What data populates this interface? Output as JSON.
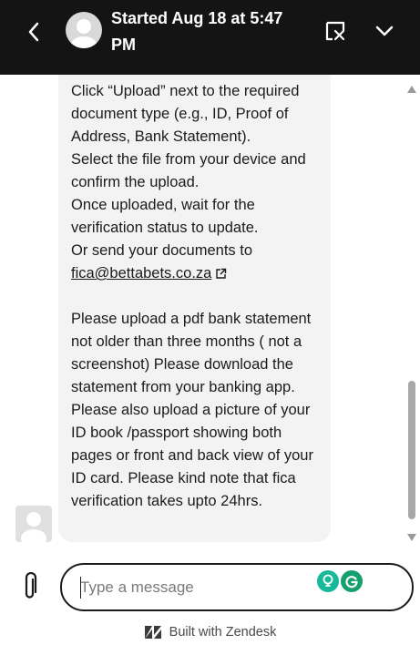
{
  "header": {
    "title": "Started Aug 18 at 5:47 PM",
    "back_icon": "chevron-left-icon",
    "end_chat_icon": "end-chat-icon",
    "minimize_icon": "chevron-down-icon"
  },
  "message": {
    "text_part1": "Click “Upload” next to the required document type (e.g., ID, Proof of Address, Bank Statement).\nSelect the file from your device and confirm the upload.\nOnce uploaded, wait for the verification status to update.\nOr send your documents to\n",
    "email_link": "fica@bettabets.co.za",
    "text_part2": "\n\nPlease upload a pdf bank statement not older than three months ( not a screenshot) Please download the statement from your banking app. Please also upload a picture of your ID book /passport showing both pages or front and back view of your ID card.   Please kind note that fica verification takes upto 24hrs."
  },
  "composer": {
    "placeholder": "Type a message",
    "value": ""
  },
  "footer": {
    "label": "Built with Zendesk",
    "logo_icon": "zendesk-logo-icon"
  },
  "colors": {
    "header_bg": "#141414",
    "bubble_bg": "#f3f3f3",
    "grammarly_green": "#15a06e",
    "bulb_teal": "#18b89a"
  }
}
